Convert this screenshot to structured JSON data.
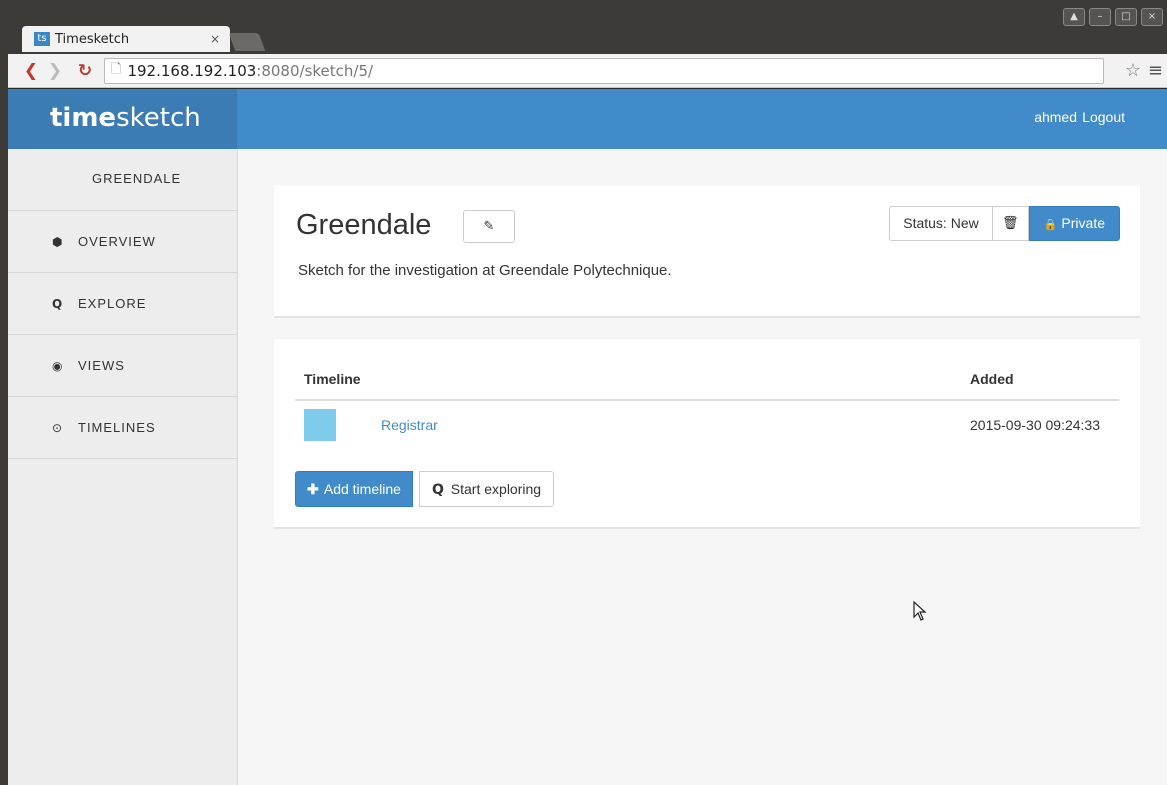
{
  "browser": {
    "tab_favicon": "ts",
    "tab_title": "Timesketch",
    "tab_close": "×",
    "url_host": "192.168.192.103",
    "url_path": ":8080/sketch/5/"
  },
  "navbar": {
    "brand_bold": "time",
    "brand_light": "sketch",
    "user": "ahmed",
    "logout": "Logout"
  },
  "sidebar": {
    "title": "GREENDALE",
    "items": [
      {
        "label": "OVERVIEW",
        "icon": "cube-icon"
      },
      {
        "label": "EXPLORE",
        "icon": "search-icon"
      },
      {
        "label": "VIEWS",
        "icon": "eye-icon"
      },
      {
        "label": "TIMELINES",
        "icon": "clock-icon"
      }
    ]
  },
  "sketch": {
    "title": "Greendale",
    "description": "Sketch for the investigation at Greendale Polytechnique.",
    "status_label": "Status: New",
    "private_label": "Private"
  },
  "timelines": {
    "col_timeline": "Timeline",
    "col_added": "Added",
    "rows": [
      {
        "name": "Registrar",
        "added": "2015-09-30 09:24:33",
        "color": "#7ecbeb"
      }
    ],
    "add_label": "Add timeline",
    "explore_label": "Start exploring"
  },
  "colors": {
    "primary": "#428bca",
    "navbar": "#428bca"
  }
}
